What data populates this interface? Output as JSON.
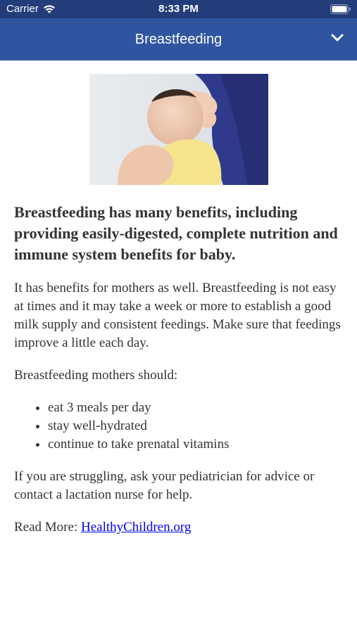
{
  "status_bar": {
    "carrier": "Carrier",
    "time": "8:33 PM"
  },
  "header": {
    "title": "Breastfeeding"
  },
  "article": {
    "headline": "Breastfeeding has many benefits, including providing easily-digested, complete nutrition and immune system benefits for baby.",
    "paragraph1": "It has benefits for mothers as well. Breastfeeding is not easy at times and it may take a week or more to establish a good milk supply and consistent feedings. Make sure that feedings improve a little each day.",
    "list_intro": "Breastfeeding mothers should:",
    "list": [
      "eat 3 meals per day",
      "stay well-hydrated",
      "continue to take prenatal vitamins"
    ],
    "paragraph2": "If you are struggling, ask your pediatrician for advice or contact a lactation nurse for help.",
    "read_more_label": "Read More:",
    "read_more_link": "HealthyChildren.org"
  }
}
